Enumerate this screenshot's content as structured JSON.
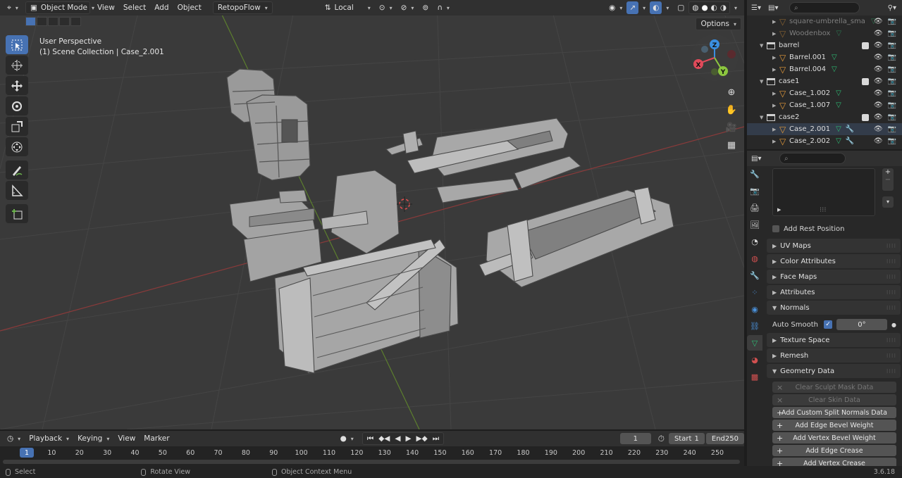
{
  "viewport_header": {
    "mode": "Object Mode",
    "menus": [
      "View",
      "Select",
      "Add",
      "Object",
      "RetopoFlow"
    ],
    "transform_orientation": "Local",
    "options_label": "Options"
  },
  "viewport_info": {
    "line1": "User Perspective",
    "line2": "(1) Scene Collection | Case_2.001"
  },
  "gizmo": {
    "x": "X",
    "y": "Y",
    "z": "Z"
  },
  "toolbar_tools": [
    "select-box",
    "cursor",
    "move",
    "rotate",
    "scale",
    "transform",
    "annotate",
    "measure",
    "add-cube"
  ],
  "outliner": {
    "search_placeholder": "",
    "rows": [
      {
        "name": "square-umbrella_sma",
        "type": "object",
        "dim": true
      },
      {
        "name": "Woodenbox",
        "type": "object",
        "dim": true
      },
      {
        "name": "barrel",
        "type": "collection"
      },
      {
        "name": "Barrel.001",
        "type": "object"
      },
      {
        "name": "Barrel.004",
        "type": "object"
      },
      {
        "name": "case1",
        "type": "collection"
      },
      {
        "name": "Case_1.002",
        "type": "object"
      },
      {
        "name": "Case_1.007",
        "type": "object"
      },
      {
        "name": "case2",
        "type": "collection"
      },
      {
        "name": "Case_2.001",
        "type": "object",
        "selected": true
      },
      {
        "name": "Case_2.002",
        "type": "object"
      }
    ]
  },
  "properties": {
    "add_rest_position": "Add Rest Position",
    "panels": [
      "UV Maps",
      "Color Attributes",
      "Face Maps",
      "Attributes",
      "Normals"
    ],
    "auto_smooth_label": "Auto Smooth",
    "auto_smooth_angle": "0°",
    "panels2": [
      "Texture Space",
      "Remesh",
      "Geometry Data"
    ],
    "geometry_buttons": [
      {
        "label": "Clear Sculpt Mask Data",
        "enabled": false
      },
      {
        "label": "Clear Skin Data",
        "enabled": false
      },
      {
        "label": "Add Custom Split Normals Data",
        "enabled": true
      },
      {
        "label": "Add Edge Bevel Weight",
        "enabled": true
      },
      {
        "label": "Add Vertex Bevel Weight",
        "enabled": true
      },
      {
        "label": "Add Edge Crease",
        "enabled": true
      },
      {
        "label": "Add Vertex Crease",
        "enabled": true
      }
    ]
  },
  "timeline": {
    "menus": [
      "Playback",
      "Keying",
      "View",
      "Marker"
    ],
    "current_frame": "1",
    "start_label": "Start",
    "start_value": "1",
    "end_label": "End",
    "end_value": "250",
    "ticks": [
      "1",
      "10",
      "20",
      "30",
      "40",
      "50",
      "60",
      "70",
      "80",
      "90",
      "100",
      "110",
      "120",
      "130",
      "140",
      "150",
      "160",
      "170",
      "180",
      "190",
      "200",
      "210",
      "220",
      "230",
      "240",
      "250"
    ]
  },
  "status": {
    "select": "Select",
    "rotate": "Rotate View",
    "context": "Object Context Menu",
    "version": "3.6.18"
  },
  "colors": {
    "accent": "#4772b3",
    "object_icon": "#e39a3a",
    "mesh_icon": "#2dbd74",
    "axis_x": "#e04a5a",
    "axis_y": "#8cc63f",
    "axis_z": "#3a8fe0"
  }
}
